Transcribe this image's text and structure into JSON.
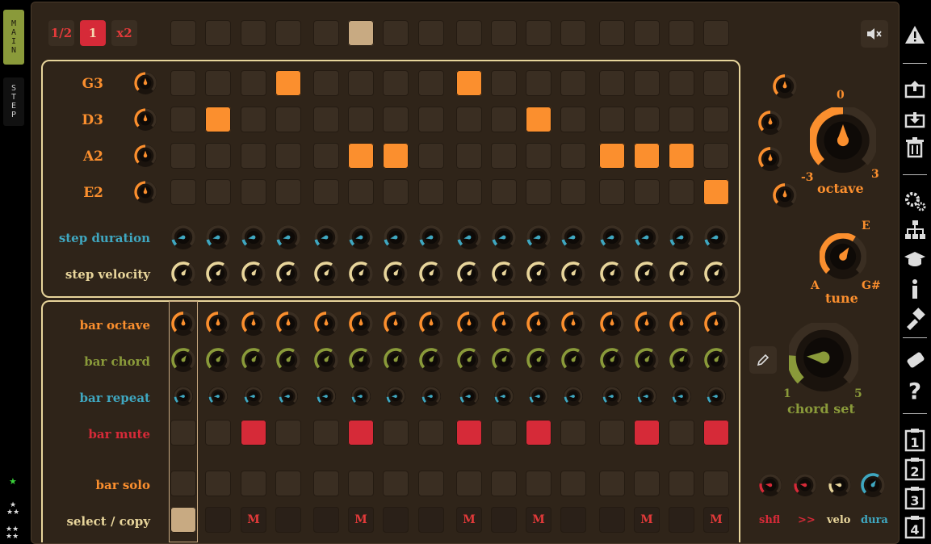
{
  "sidebar": {
    "tab_main": "MAIN",
    "tab_step": "STEP"
  },
  "speed": [
    "1/2",
    "1",
    "x2"
  ],
  "playhead_index": 5,
  "notes": {
    "rows": [
      {
        "label": "G3",
        "steps": [
          0,
          0,
          0,
          1,
          0,
          0,
          0,
          0,
          1,
          0,
          0,
          0,
          0,
          0,
          0,
          0
        ]
      },
      {
        "label": "D3",
        "steps": [
          0,
          1,
          0,
          0,
          0,
          0,
          0,
          0,
          0,
          0,
          1,
          0,
          0,
          0,
          0,
          0
        ]
      },
      {
        "label": "A2",
        "steps": [
          0,
          0,
          0,
          0,
          0,
          1,
          1,
          0,
          0,
          0,
          0,
          0,
          1,
          1,
          1,
          0
        ]
      },
      {
        "label": "E2",
        "steps": [
          0,
          0,
          0,
          0,
          0,
          0,
          0,
          0,
          0,
          0,
          0,
          0,
          0,
          0,
          0,
          1
        ]
      }
    ]
  },
  "step_duration_label": "step duration",
  "step_velocity_label": "step velocity",
  "bars": {
    "octave_label": "bar octave",
    "chord_label": "bar chord",
    "repeat_label": "bar repeat",
    "mute_label": "bar mute",
    "solo_label": "bar solo",
    "select_label": "select / copy",
    "mute": [
      0,
      0,
      1,
      0,
      0,
      1,
      0,
      0,
      1,
      0,
      1,
      0,
      0,
      1,
      0,
      1
    ],
    "select": [
      1,
      0,
      0,
      0,
      0,
      0,
      0,
      0,
      0,
      0,
      0,
      0,
      0,
      0,
      0,
      0
    ],
    "mute_mark": "M"
  },
  "octave": {
    "label": "octave",
    "min": "-3",
    "max": "3",
    "value": "0"
  },
  "tune": {
    "label": "tune",
    "min": "A",
    "max": "G#",
    "value": "E"
  },
  "chord_set": {
    "label": "chord set",
    "min": "1",
    "max": "5"
  },
  "bottom_knobs": {
    "shfl": "shfl",
    "next": ">>",
    "velo": "velo",
    "dura": "dura"
  },
  "right_icons": [
    "alert-icon",
    "upload-icon",
    "download-icon",
    "trash-icon",
    "gear-icon",
    "tree-icon",
    "graduation-icon",
    "info-icon",
    "paint-icon",
    "eraser-icon",
    "help-icon",
    "clipboard-1-icon",
    "clipboard-2-icon",
    "clipboard-3-icon",
    "clipboard-4-icon"
  ],
  "right_icon_labels": {
    "c1": "1",
    "c2": "2",
    "c3": "3",
    "c4": "4",
    "info": "i",
    "help": "?"
  },
  "colors": {
    "orange": "#fb8f2e",
    "red": "#d62a38",
    "tan": "#c8aa82",
    "green": "#8a9a3a",
    "teal": "#3fa7c0",
    "cream": "#e8d59b"
  }
}
